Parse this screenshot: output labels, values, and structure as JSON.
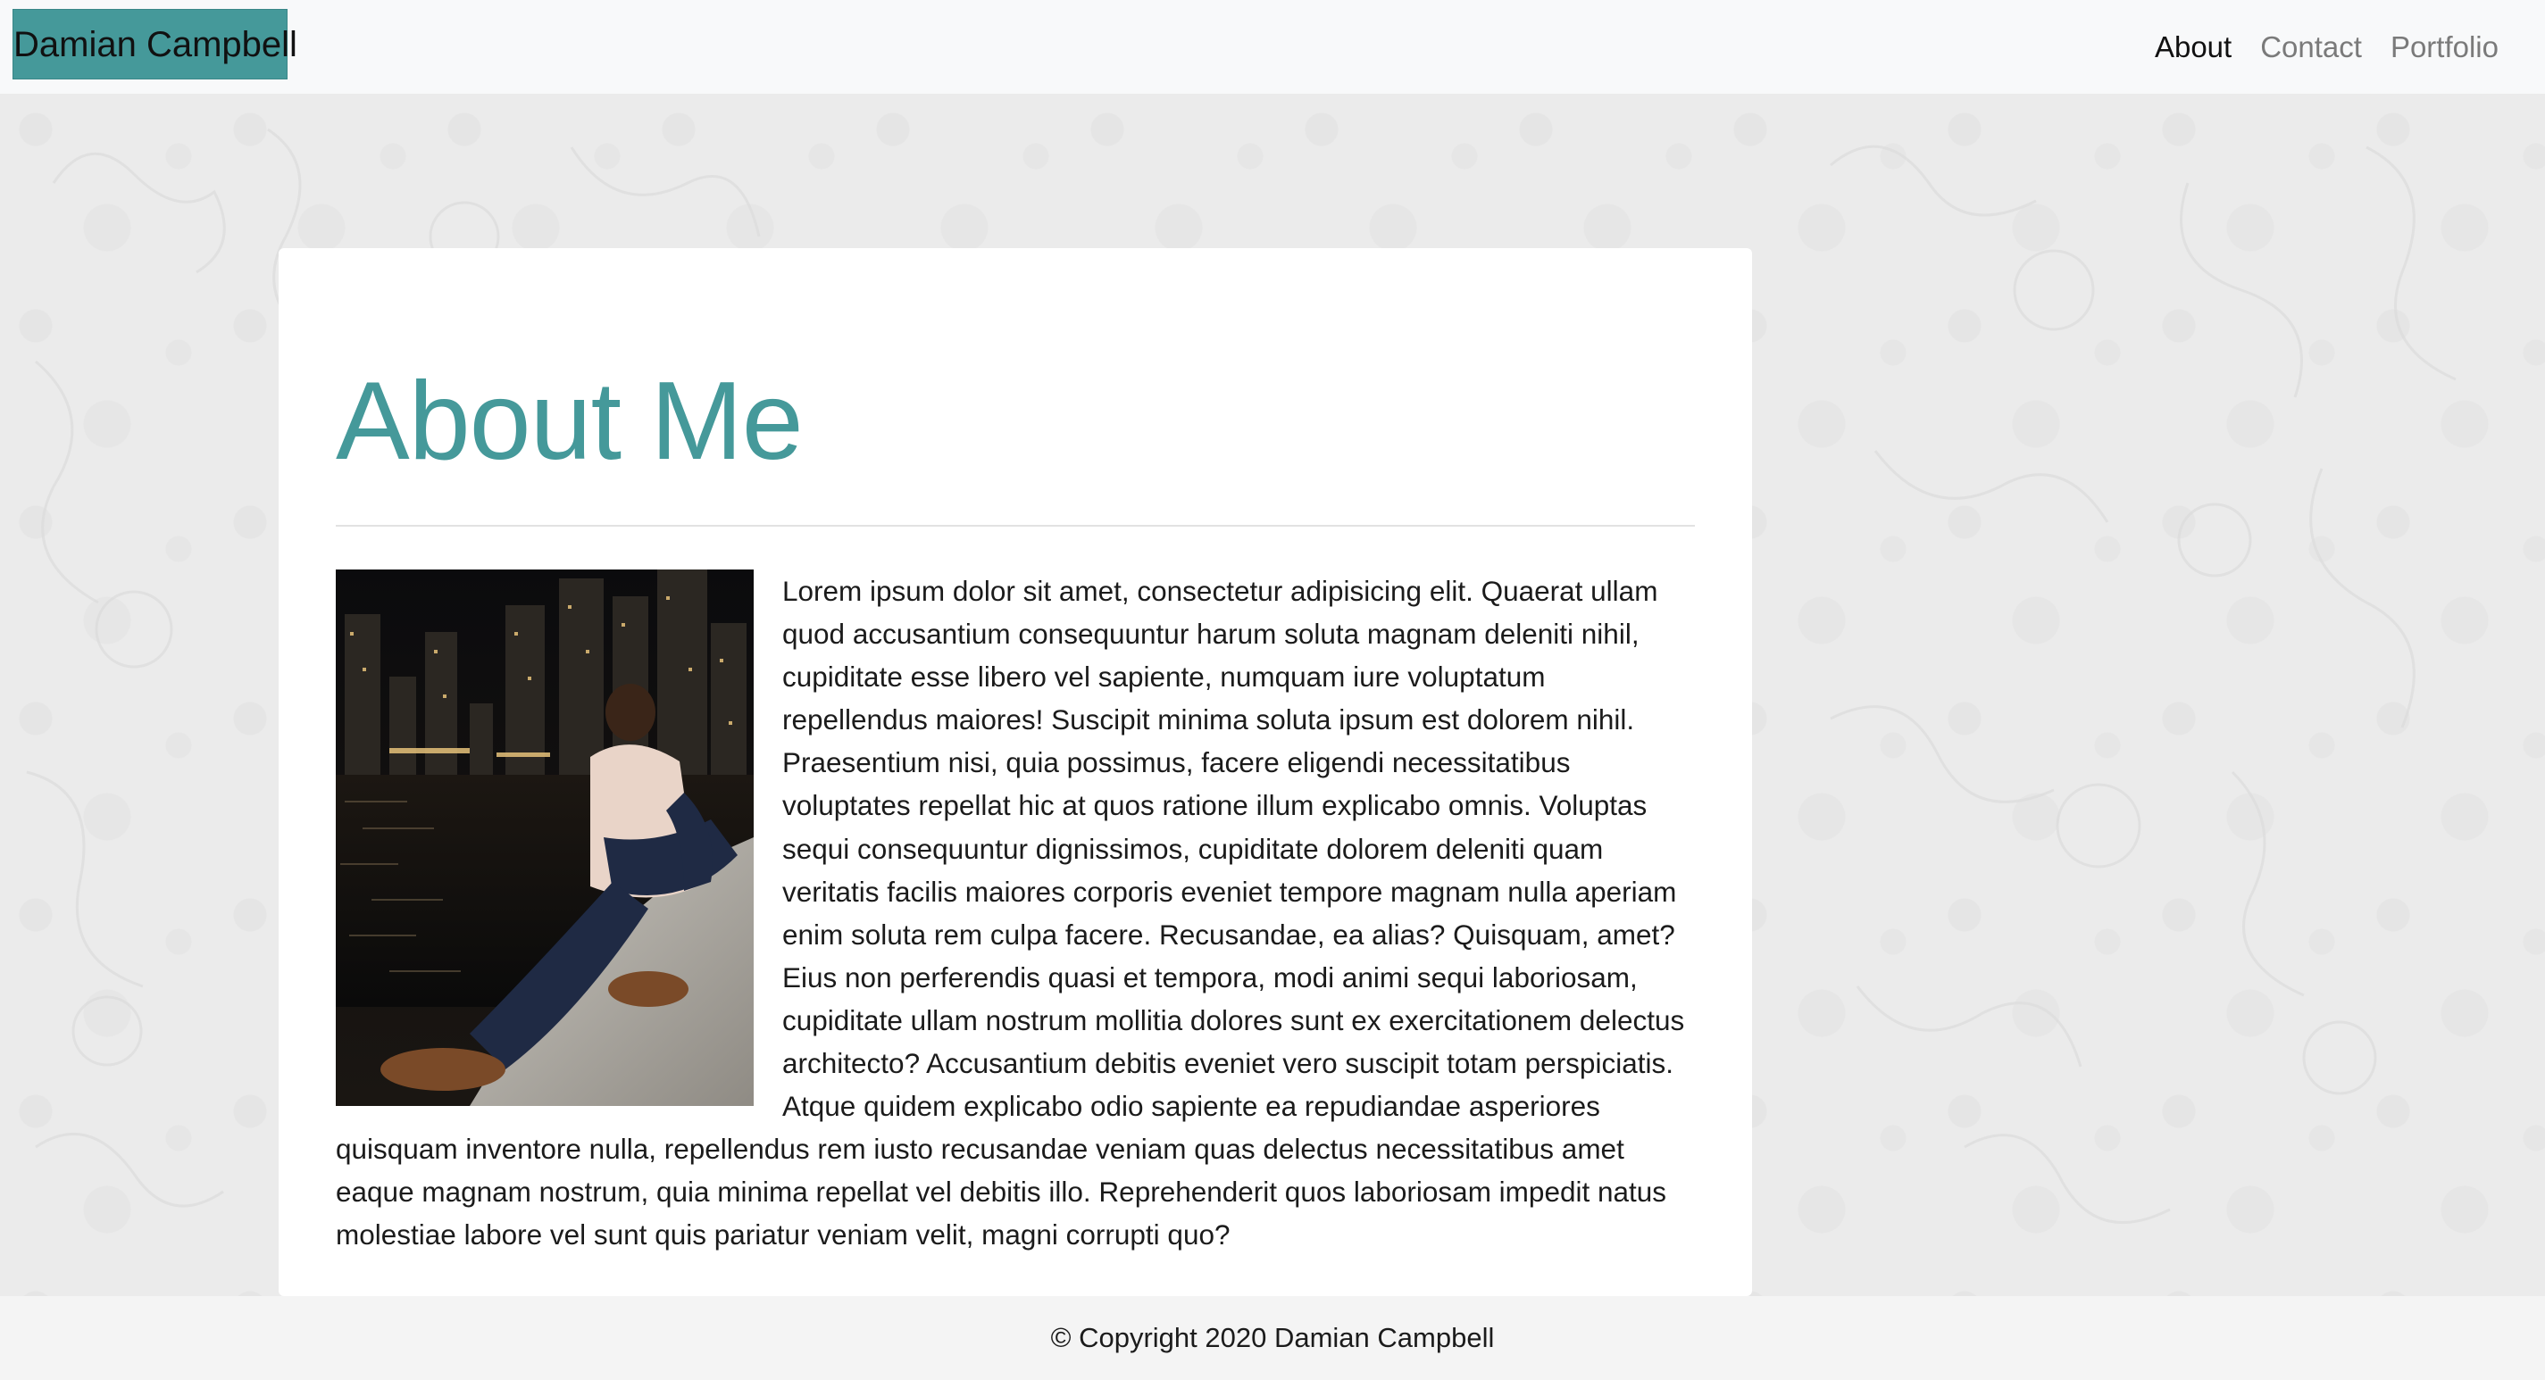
{
  "navbar": {
    "brand": "Damian Campbell",
    "links": [
      {
        "label": "About",
        "active": true
      },
      {
        "label": "Contact",
        "active": false
      },
      {
        "label": "Portfolio",
        "active": false
      }
    ]
  },
  "main": {
    "title": "About Me",
    "photo_alt": "Damian Campbell sitting on a ledge by the waterfront at night",
    "paragraph": "Lorem ipsum dolor sit amet, consectetur adipisicing elit. Quaerat ullam quod accusantium consequuntur harum soluta magnam deleniti nihil, cupiditate esse libero vel sapiente, numquam iure voluptatum repellendus maiores! Suscipit minima soluta ipsum est dolorem nihil. Praesentium nisi, quia possimus, facere eligendi necessitatibus voluptates repellat hic at quos ratione illum explicabo omnis. Voluptas sequi consequuntur dignissimos, cupiditate dolorem deleniti quam veritatis facilis maiores corporis eveniet tempore magnam nulla aperiam enim soluta rem culpa facere. Recusandae, ea alias? Quisquam, amet? Eius non perferendis quasi et tempora, modi animi sequi laboriosam, cupiditate ullam nostrum mollitia dolores sunt ex exercitationem delectus architecto? Accusantium debitis eveniet vero suscipit totam perspiciatis. Atque quidem explicabo odio sapiente ea repudiandae asperiores quisquam inventore nulla, repellendus rem iusto recusandae veniam quas delectus necessitatibus amet eaque magnam nostrum, quia minima repellat vel debitis illo. Reprehenderit quos laboriosam impedit natus molestiae labore vel sunt quis pariatur veniam velit, magni corrupti quo?"
  },
  "footer": {
    "copyright": "© Copyright 2020 Damian Campbell"
  },
  "colors": {
    "accent": "#45999a",
    "navbar_bg": "#f8f9fa",
    "page_bg": "#ebebeb",
    "footer_bg": "#f4f4f4"
  }
}
